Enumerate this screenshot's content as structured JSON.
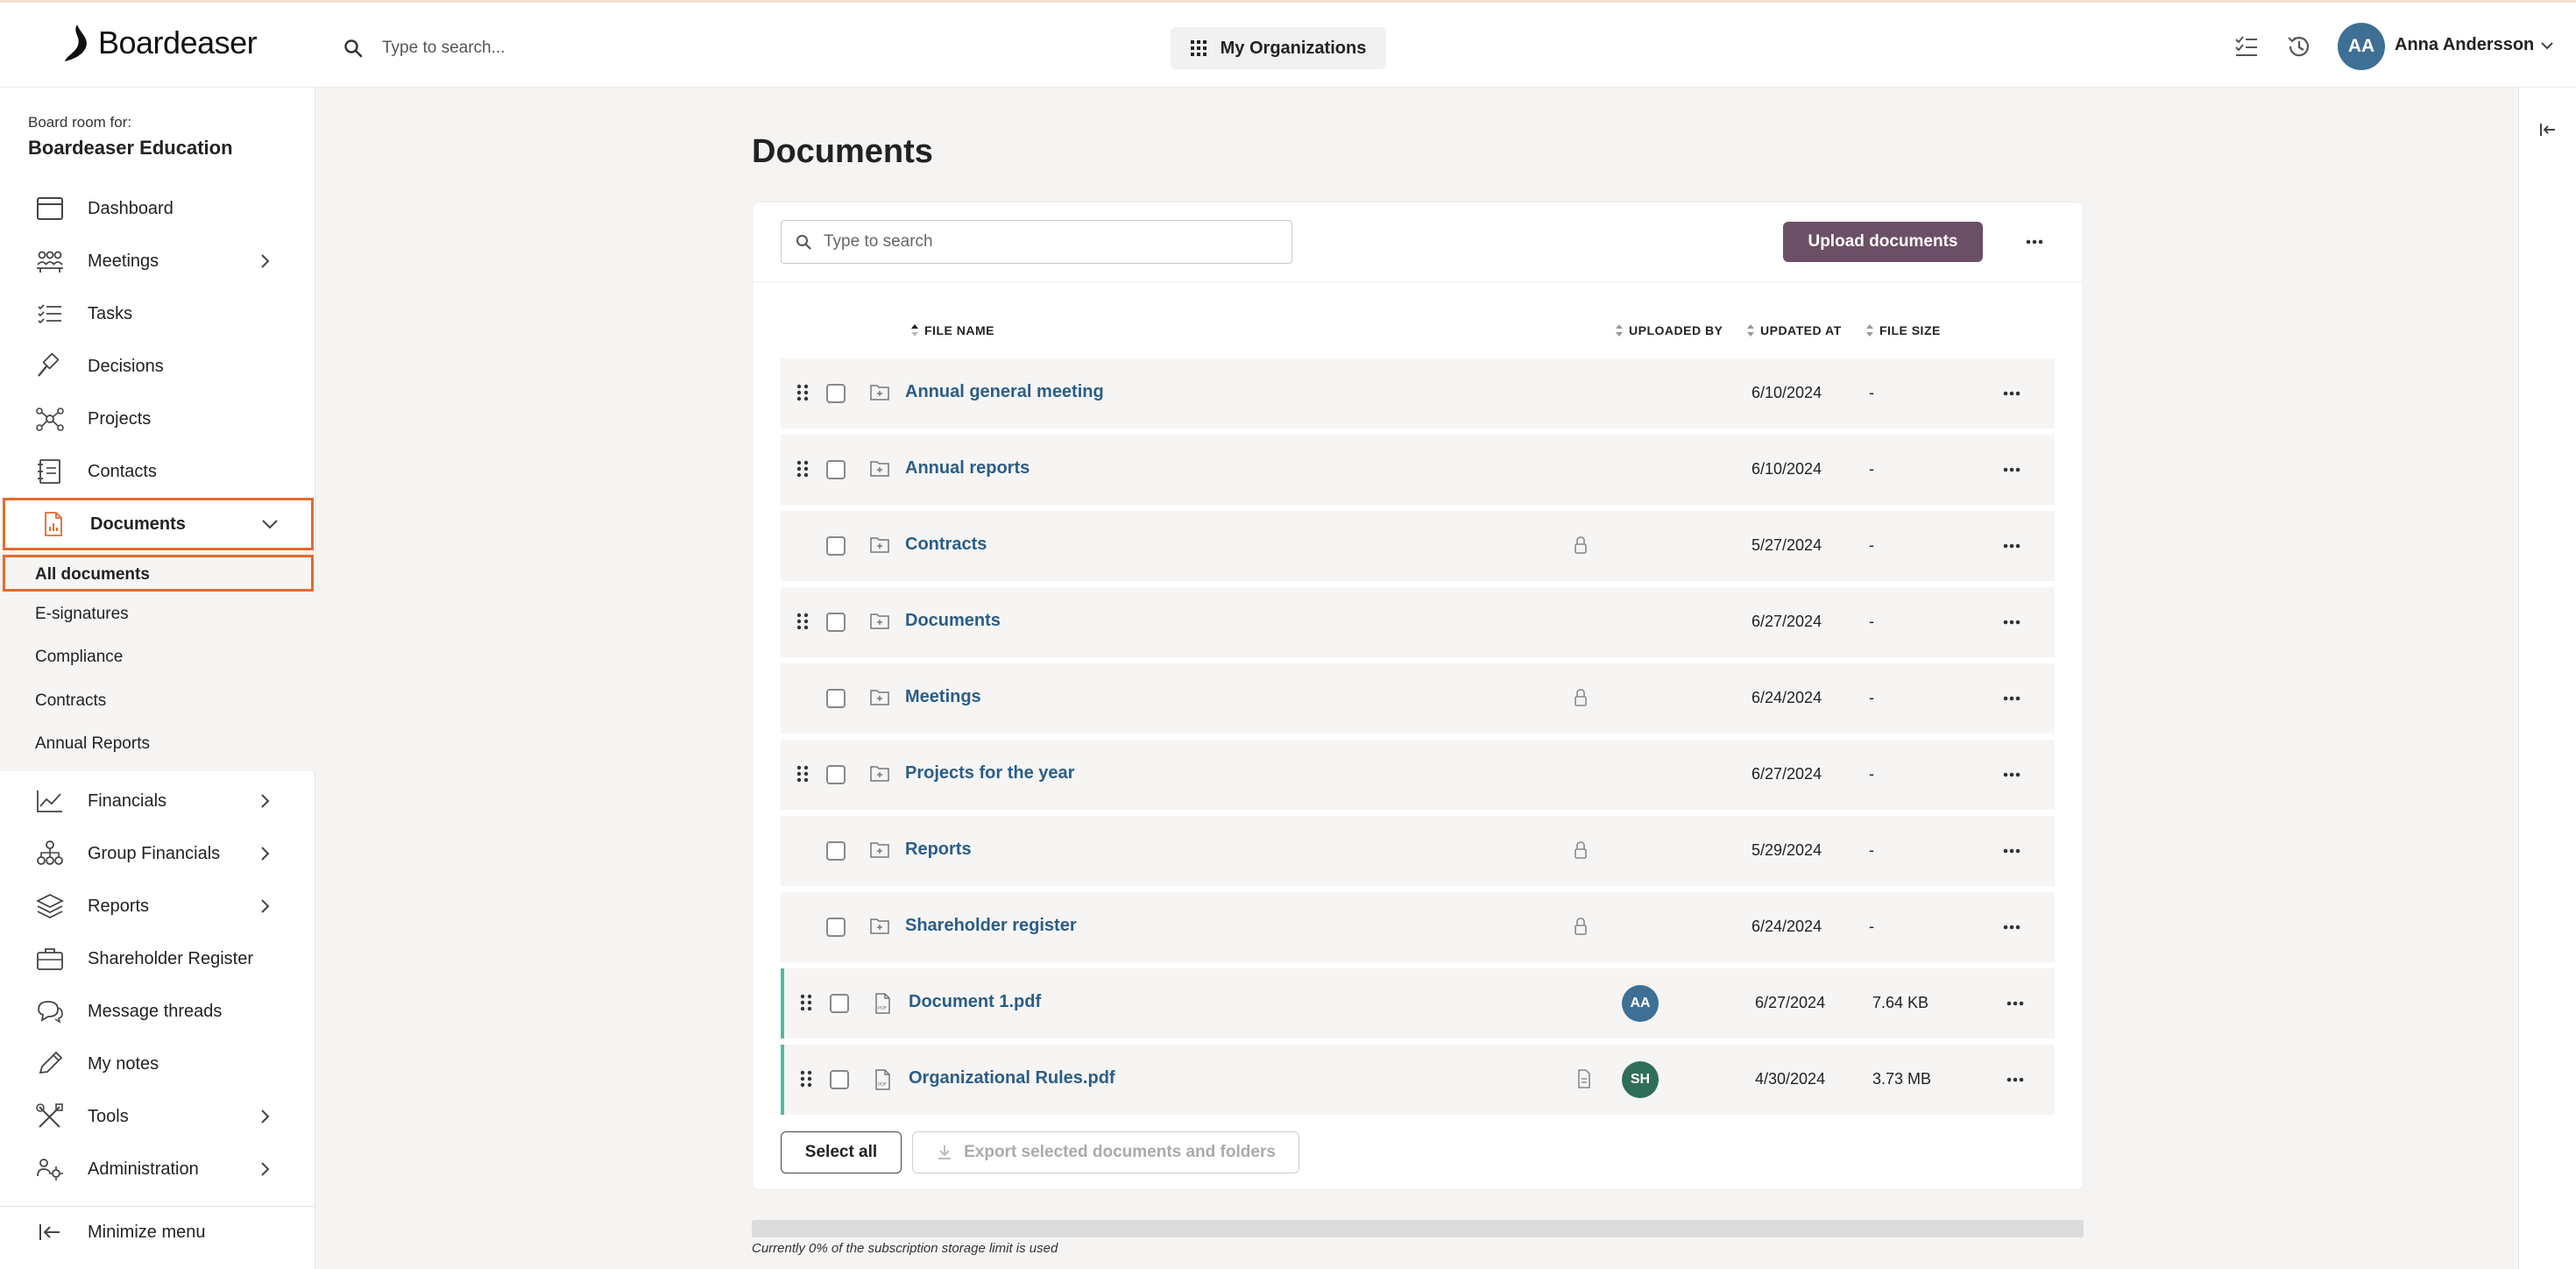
{
  "header": {
    "logo_text": "Boardeaser",
    "search_placeholder": "Type to search...",
    "org_button_label": "My Organizations",
    "user": {
      "initials": "AA",
      "name": "Anna Andersson"
    }
  },
  "sidebar": {
    "board_for_label": "Board room for:",
    "board_name": "Boardeaser Education",
    "items": [
      {
        "label": "Dashboard",
        "icon": "dashboard-icon",
        "has_chevron": false
      },
      {
        "label": "Meetings",
        "icon": "meetings-icon",
        "has_chevron": true
      },
      {
        "label": "Tasks",
        "icon": "tasks-icon",
        "has_chevron": false
      },
      {
        "label": "Decisions",
        "icon": "gavel-icon",
        "has_chevron": false
      },
      {
        "label": "Projects",
        "icon": "projects-icon",
        "has_chevron": false
      },
      {
        "label": "Contacts",
        "icon": "contacts-icon",
        "has_chevron": false
      },
      {
        "label": "Documents",
        "icon": "documents-icon",
        "has_chevron": true,
        "expanded": true
      },
      {
        "label": "Financials",
        "icon": "chart-icon",
        "has_chevron": true
      },
      {
        "label": "Group Financials",
        "icon": "group-icon",
        "has_chevron": true
      },
      {
        "label": "Reports",
        "icon": "layers-icon",
        "has_chevron": true
      },
      {
        "label": "Shareholder Register",
        "icon": "briefcase-icon",
        "has_chevron": false
      },
      {
        "label": "Message threads",
        "icon": "chat-icon",
        "has_chevron": false
      },
      {
        "label": "My notes",
        "icon": "pencil-icon",
        "has_chevron": false
      },
      {
        "label": "Tools",
        "icon": "tools-icon",
        "has_chevron": true
      },
      {
        "label": "Administration",
        "icon": "admin-icon",
        "has_chevron": true
      }
    ],
    "documents_subitems": [
      "All documents",
      "E-signatures",
      "Compliance",
      "Contracts",
      "Annual Reports"
    ],
    "minimize_label": "Minimize menu"
  },
  "main": {
    "title": "Documents",
    "search_placeholder": "Type to search",
    "upload_label": "Upload documents",
    "columns": {
      "file_name": "FILE NAME",
      "uploaded_by": "UPLOADED BY",
      "updated_at": "UPDATED AT",
      "file_size": "FILE SIZE"
    },
    "rows": [
      {
        "name": "Annual general meeting",
        "type": "folder",
        "draggable": true,
        "locked": false,
        "uploader": "",
        "updated": "6/10/2024",
        "size": "-"
      },
      {
        "name": "Annual reports",
        "type": "folder",
        "draggable": true,
        "locked": false,
        "uploader": "",
        "updated": "6/10/2024",
        "size": "-"
      },
      {
        "name": "Contracts",
        "type": "folder",
        "draggable": false,
        "locked": true,
        "uploader": "",
        "updated": "5/27/2024",
        "size": "-"
      },
      {
        "name": "Documents",
        "type": "folder",
        "draggable": true,
        "locked": false,
        "uploader": "",
        "updated": "6/27/2024",
        "size": "-"
      },
      {
        "name": "Meetings",
        "type": "folder",
        "draggable": false,
        "locked": true,
        "uploader": "",
        "updated": "6/24/2024",
        "size": "-"
      },
      {
        "name": "Projects for the year",
        "type": "folder",
        "draggable": true,
        "locked": false,
        "uploader": "",
        "updated": "6/27/2024",
        "size": "-"
      },
      {
        "name": "Reports",
        "type": "folder",
        "draggable": false,
        "locked": true,
        "uploader": "",
        "updated": "5/29/2024",
        "size": "-"
      },
      {
        "name": "Shareholder register",
        "type": "folder",
        "draggable": false,
        "locked": true,
        "uploader": "",
        "updated": "6/24/2024",
        "size": "-"
      },
      {
        "name": "Document 1.pdf",
        "type": "pdf",
        "draggable": true,
        "locked": false,
        "uploader": "AA",
        "uploader_color": "#3e6f94",
        "updated": "6/27/2024",
        "size": "7.64 KB"
      },
      {
        "name": "Organizational Rules.pdf",
        "type": "pdf",
        "draggable": true,
        "locked": false,
        "doc_badge": true,
        "uploader": "SH",
        "uploader_color": "#2f6e5a",
        "updated": "4/30/2024",
        "size": "3.73 MB"
      }
    ],
    "select_all_label": "Select all",
    "export_label": "Export selected documents and folders",
    "storage": {
      "percent_used": 0,
      "text": "Currently 0% of the subscription storage limit is used"
    }
  },
  "colors": {
    "accent_orange": "#e46a2e",
    "upload_button": "#6b4f66",
    "link_blue": "#2b5d86",
    "file_marker": "#57b8a2"
  }
}
